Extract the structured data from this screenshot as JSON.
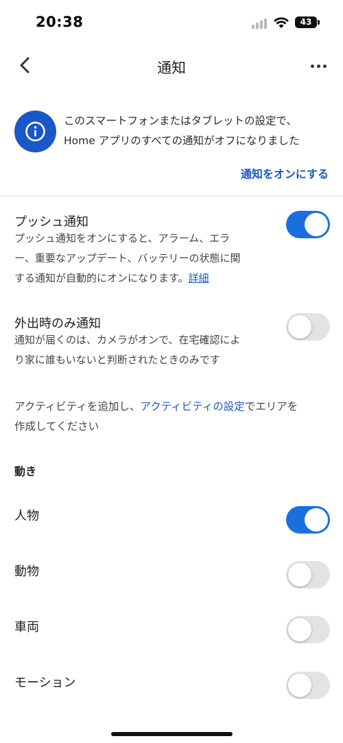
{
  "status_bar": {
    "time": "20:38",
    "battery": "43"
  },
  "header": {
    "title": "通知"
  },
  "banner": {
    "line1": "このスマートフォンまたはタブレットの設定で、",
    "line2": "Home アプリのすべての通知がオフになりました",
    "action": "通知をオンにする"
  },
  "push": {
    "title": "プッシュ通知",
    "desc_line1": "プッシュ通知をオンにすると、アラーム、エラ",
    "desc_line2": "ー、重要なアップデート、バッテリーの状態に関",
    "desc_line3": "する通知が自動的にオンになります。",
    "link": "詳細",
    "enabled": true
  },
  "away": {
    "title": "外出時のみ通知",
    "desc_line1": "通知が届くのは、カメラがオンで、在宅確認によ",
    "desc_line2": "り家に誰もいないと判断されたときのみです",
    "enabled": false
  },
  "activity": {
    "prefix": "アクティビティを追加し、",
    "link": "アクティビティの設定",
    "suffix": "でエリアを",
    "line2": "作成してください"
  },
  "motion_section": {
    "heading": "動き",
    "items": [
      {
        "label": "人物",
        "enabled": true
      },
      {
        "label": "動物",
        "enabled": false
      },
      {
        "label": "車両",
        "enabled": false
      },
      {
        "label": "モーション",
        "enabled": false
      }
    ]
  },
  "colors": {
    "accent": "#1a57c9",
    "toggle_on": "#1a6fe0",
    "toggle_off": "#e3e3e3"
  }
}
